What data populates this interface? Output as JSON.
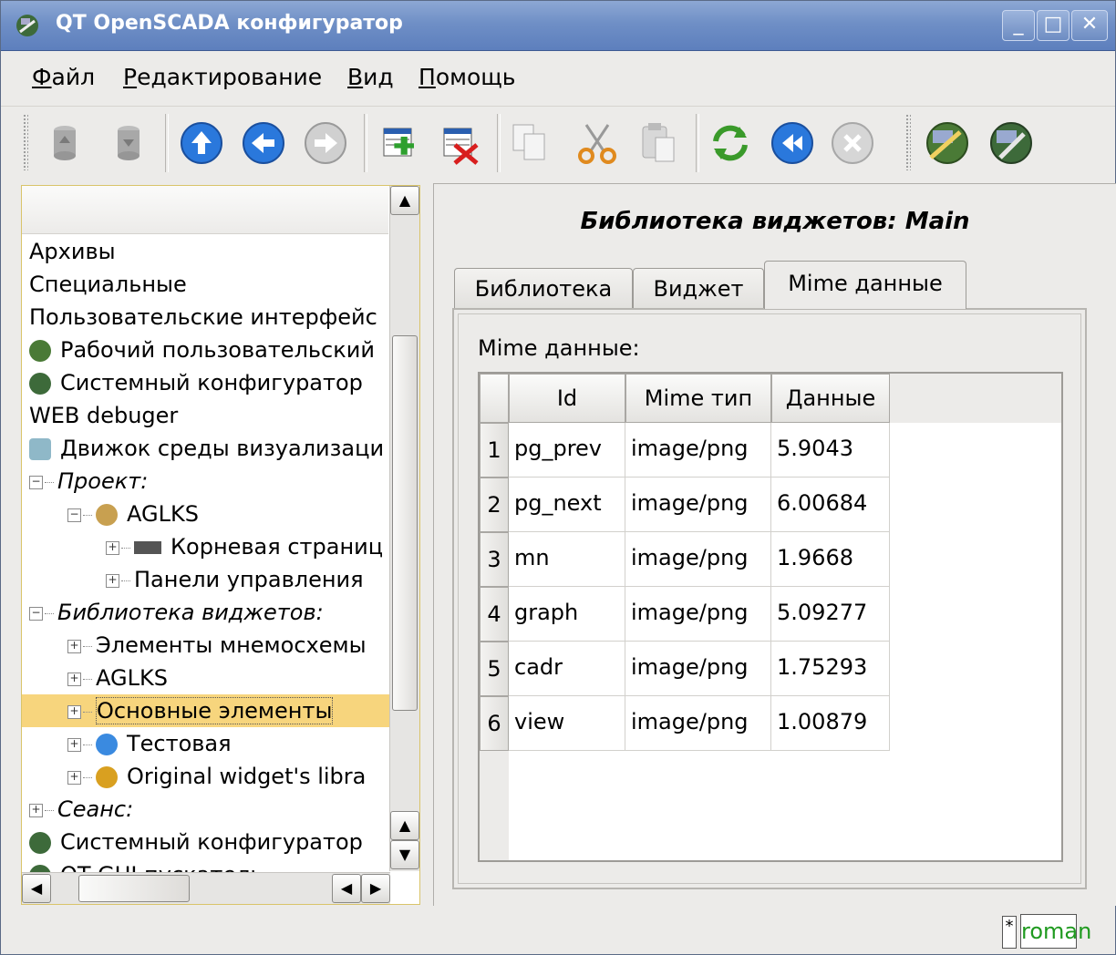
{
  "window": {
    "title": "QT OpenSCADA конфигуратор",
    "buttons": [
      "_",
      "□",
      "✕"
    ]
  },
  "menu": [
    {
      "label": "Файл",
      "mnemonic": "Ф",
      "rest": "айл"
    },
    {
      "label": "Редактирование",
      "mnemonic": "Р",
      "rest": "едактирование"
    },
    {
      "label": "Вид",
      "mnemonic": "В",
      "rest": "ид"
    },
    {
      "label": "Помощь",
      "mnemonic": "П",
      "rest": "омощь"
    }
  ],
  "toolbar": {
    "icons": [
      "db-load-icon",
      "db-save-icon",
      "up-arrow-icon",
      "back-arrow-icon",
      "forward-arrow-icon",
      "add-item-icon",
      "delete-item-icon",
      "copy-icon",
      "cut-icon",
      "paste-icon",
      "refresh-icon",
      "start-icon",
      "stop-icon",
      "vision-icon",
      "configurator-icon"
    ]
  },
  "tree": {
    "rows": [
      {
        "label": "Архивы",
        "indent": 0,
        "italic": false,
        "expander": "",
        "icon": ""
      },
      {
        "label": "Специальные",
        "indent": 0,
        "italic": false,
        "expander": "",
        "icon": ""
      },
      {
        "label": "Пользовательские интерфейс",
        "indent": 0,
        "italic": false,
        "expander": "",
        "icon": ""
      },
      {
        "label": "Рабочий пользовательский",
        "indent": 0,
        "italic": false,
        "expander": "",
        "icon": "vision-icon"
      },
      {
        "label": "Системный конфигуратор",
        "indent": 0,
        "italic": false,
        "expander": "",
        "icon": "configurator-icon"
      },
      {
        "label": "WEB debuger",
        "indent": 0,
        "italic": false,
        "expander": "",
        "icon": ""
      },
      {
        "label": "Движок среды визуализаци",
        "indent": 0,
        "italic": false,
        "expander": "",
        "icon": "engine-icon"
      },
      {
        "label": "Проект:",
        "indent": 0,
        "italic": true,
        "expander": "−",
        "icon": ""
      },
      {
        "label": "AGLKS",
        "indent": 1,
        "italic": false,
        "expander": "−",
        "icon": "project-icon"
      },
      {
        "label": "Корневая страниц",
        "indent": 2,
        "italic": false,
        "expander": "+",
        "icon": "page-icon"
      },
      {
        "label": "Панели управления",
        "indent": 2,
        "italic": false,
        "expander": "+",
        "icon": ""
      },
      {
        "label": "Библиотека виджетов:",
        "indent": 0,
        "italic": true,
        "expander": "−",
        "icon": ""
      },
      {
        "label": "Элементы мнемосхемы",
        "indent": 1,
        "italic": false,
        "expander": "+",
        "icon": ""
      },
      {
        "label": "AGLKS",
        "indent": 1,
        "italic": false,
        "expander": "+",
        "icon": ""
      },
      {
        "label": "Основные элементы",
        "indent": 1,
        "italic": false,
        "expander": "+",
        "icon": "",
        "selected": true
      },
      {
        "label": "Тестовая",
        "indent": 1,
        "italic": false,
        "expander": "+",
        "icon": "help-icon"
      },
      {
        "label": "Original widget's libra",
        "indent": 1,
        "italic": false,
        "expander": "+",
        "icon": "library-icon"
      },
      {
        "label": "Сеанс:",
        "indent": 0,
        "italic": true,
        "expander": "+",
        "icon": ""
      },
      {
        "label": "Системный конфигуратор",
        "indent": 0,
        "italic": false,
        "expander": "",
        "icon": "configurator-icon"
      },
      {
        "label": "QT GUI пускатель",
        "indent": 0,
        "italic": false,
        "expander": "",
        "icon": "launcher-icon"
      }
    ]
  },
  "panel": {
    "title": "Библиотека виджетов: Main",
    "tabs": [
      "Библиотека",
      "Виджет",
      "Mime данные"
    ],
    "active_tab": 2,
    "section_label": "Mime данные:",
    "table": {
      "columns": [
        "Id",
        "Mime тип",
        "Данные"
      ],
      "rows": [
        {
          "n": "1",
          "id": "pg_prev",
          "type": "image/png",
          "data": "5.9043"
        },
        {
          "n": "2",
          "id": "pg_next",
          "type": "image/png",
          "data": "6.00684"
        },
        {
          "n": "3",
          "id": "mn",
          "type": "image/png",
          "data": "1.9668"
        },
        {
          "n": "4",
          "id": "graph",
          "type": "image/png",
          "data": "5.09277"
        },
        {
          "n": "5",
          "id": "cadr",
          "type": "image/png",
          "data": "1.75293"
        },
        {
          "n": "6",
          "id": "view",
          "type": "image/png",
          "data": "1.00879"
        }
      ]
    }
  },
  "status": {
    "modified_flag": "*",
    "user": "roman"
  },
  "colors": {
    "title_gradient": "#6f8fc6",
    "selection": "#f7d57d",
    "user_text": "#1f9a1f"
  }
}
